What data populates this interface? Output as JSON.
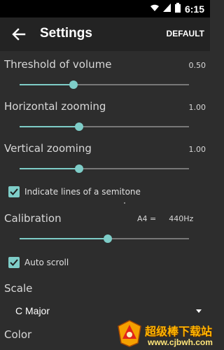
{
  "status_bar": {
    "time": "6:15",
    "icons": [
      "wifi-icon",
      "signal-icon",
      "battery-icon"
    ]
  },
  "app_bar": {
    "title": "Settings",
    "default_label": "DEFAULT",
    "back_icon": "arrow-back-icon"
  },
  "threshold": {
    "label": "Threshold of volume",
    "value": "0.50",
    "level": 0.32
  },
  "horizontal": {
    "label": "Horizontal zooming",
    "value": "1.00",
    "level": 0.35
  },
  "vertical": {
    "label": "Vertical zooming",
    "value": "1.00",
    "level": 0.35
  },
  "semitone": {
    "label": "Indicate lines of a semitone",
    "checked": true
  },
  "calibration": {
    "label": "Calibration",
    "note": "A4 =",
    "freq": "440Hz",
    "level": 0.52
  },
  "autoscroll": {
    "label": "Auto scroll",
    "checked": true
  },
  "scale": {
    "label": "Scale",
    "selected": "C Major"
  },
  "color": {
    "label": "Color"
  },
  "watermark": {
    "title": "超级棒下载站",
    "url": "www.cjbwh.com"
  },
  "colors": {
    "accent": "#7ecdc8",
    "background": "#2d2d2d",
    "appbar": "#232323"
  }
}
